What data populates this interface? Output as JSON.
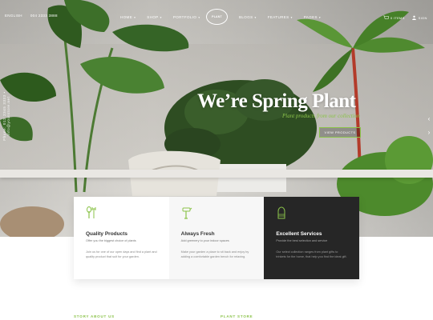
{
  "topbar": {
    "language": "ENGLISH",
    "phone": "004 2333 3888",
    "nav": [
      {
        "label": "HOME"
      },
      {
        "label": "SHOP"
      },
      {
        "label": "PORTFOLIO"
      },
      {
        "label": "BLOGS"
      },
      {
        "label": "FEATURES"
      },
      {
        "label": "PAGES"
      }
    ],
    "logo_text": "PLANT",
    "cart_label": "0 ITEMS",
    "signin_label": "SIGN"
  },
  "side": {
    "text": "Phone: 012 2345 3333 • Info@yourstore.net"
  },
  "hero": {
    "title": "We’re Spring Plant",
    "subtitle": "Plant products from our collection",
    "button_label": "VIEW PRODUCTS"
  },
  "cards": [
    {
      "title": "Quality Products",
      "tagline": "Offer you the biggest choice of plants",
      "text": "Join us for one of our open days and find a plant and quality product that suit for your garden.",
      "icon": "plant-tools-icon"
    },
    {
      "title": "Always Fresh",
      "tagline": "Add greenery to your indoor spaces",
      "text": "Make your garden a place to sit back and enjoy by adding a comfortable garden bench for relaxing.",
      "icon": "watering-icon"
    },
    {
      "title": "Excellent Services",
      "tagline": "Provide the best selection and service",
      "text": "Our select collection ranges from plant gifts to trinkets for the home, that help you find the ideal gift.",
      "icon": "glove-icon"
    }
  ],
  "sections": {
    "about_label": "STORY ABOUT US",
    "store_label": "PLANT STORE"
  },
  "colors": {
    "accent": "#8bc34a",
    "dark_card": "#262626"
  }
}
